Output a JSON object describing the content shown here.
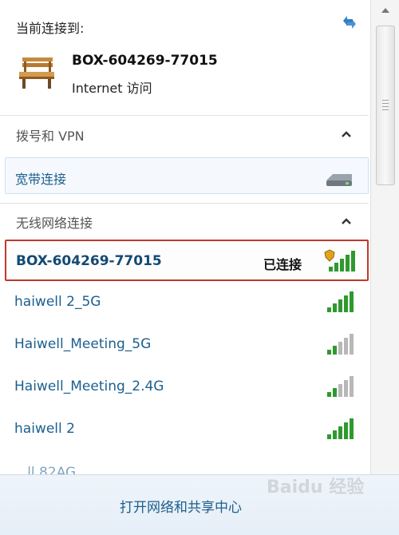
{
  "current": {
    "title": "当前连接到:",
    "network_name": "BOX-604269-77015",
    "access": "Internet 访问",
    "icon": "bench-icon"
  },
  "groups": {
    "dialup": {
      "title": "拨号和 VPN",
      "item": "宽带连接"
    },
    "wireless": {
      "title": "无线网络连接"
    }
  },
  "networks": [
    {
      "name": "BOX-604269-77015",
      "status": "已连接",
      "signal": 5
    },
    {
      "name": "haiwell 2_5G",
      "signal": 5
    },
    {
      "name": "Haiwell_Meeting_5G",
      "signal": 2
    },
    {
      "name": "Haiwell_Meeting_2.4G",
      "signal": 2
    },
    {
      "name": "haiwell 2",
      "signal": 5
    }
  ],
  "partial_network": "...ll 82AG",
  "footer": {
    "link": "打开网络和共享中心"
  },
  "watermark": "Baidu 经验",
  "colors": {
    "link": "#1b5f8e",
    "selected_border": "#c0392b",
    "signal_on": "#2e9a2e",
    "signal_off": "#b8b8b8"
  }
}
